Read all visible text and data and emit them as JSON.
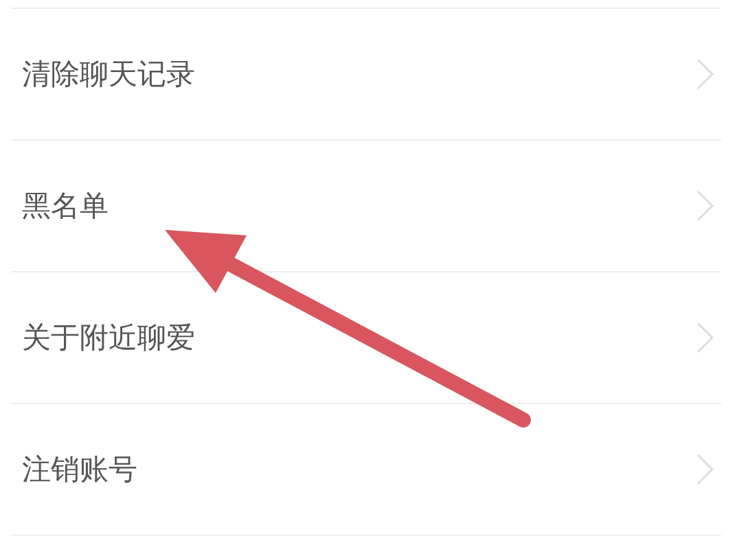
{
  "settings_list": [
    {
      "label": "清除聊天记录"
    },
    {
      "label": "黑名单"
    },
    {
      "label": "关于附近聊爱"
    },
    {
      "label": "注销账号"
    }
  ],
  "annotations": [
    {
      "kind": "arrow"
    }
  ]
}
